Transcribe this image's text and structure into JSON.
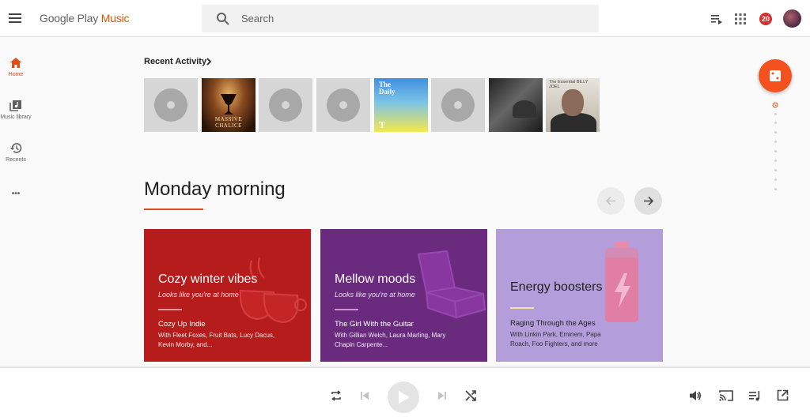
{
  "header": {
    "logo_main": "Google Play ",
    "logo_accent": "Music",
    "search_placeholder": "Search",
    "notification_count": "20"
  },
  "nav": {
    "items": [
      {
        "label": "Home",
        "icon": "home-icon",
        "active": true
      },
      {
        "label": "Music library",
        "icon": "library-icon"
      },
      {
        "label": "Recents",
        "icon": "history-icon"
      }
    ],
    "more_label": "•••"
  },
  "recent": {
    "title": "Recent Activity",
    "thumbnails": [
      {
        "kind": "placeholder"
      },
      {
        "kind": "album",
        "title": "MASSIVE CHALICE"
      },
      {
        "kind": "placeholder"
      },
      {
        "kind": "placeholder"
      },
      {
        "kind": "podcast",
        "title": "The Daily",
        "mark": "T"
      },
      {
        "kind": "placeholder"
      },
      {
        "kind": "album"
      },
      {
        "kind": "album",
        "title": "The Essential BILLY JOEL"
      }
    ]
  },
  "section": {
    "title": "Monday morning",
    "accent_color": "#e64a19"
  },
  "cards": [
    {
      "title": "Cozy winter vibes",
      "subtitle": "Looks like you're at home",
      "playlist": "Cozy Up Indie",
      "description": "With Fleet Foxes, Fruit Bats, Lucy Dacus, Kevin Morby, and...",
      "color": "#b71c1c"
    },
    {
      "title": "Mellow moods",
      "subtitle": "Looks like you're at home",
      "playlist": "The Girl With the Guitar",
      "description": "With Gillian Welch, Laura Marling, Mary Chapin Carpente...",
      "color": "#6a2b7f"
    },
    {
      "title": "Energy boosters",
      "playlist": "Raging Through the Ages",
      "description": "With Linkin Park, Eminem, Papa Roach, Foo Fighters, and more",
      "color": "#b39ddb"
    }
  ],
  "colors": {
    "brand": "#e65100",
    "fab": "#f4511e",
    "badge": "#d32f2f"
  }
}
